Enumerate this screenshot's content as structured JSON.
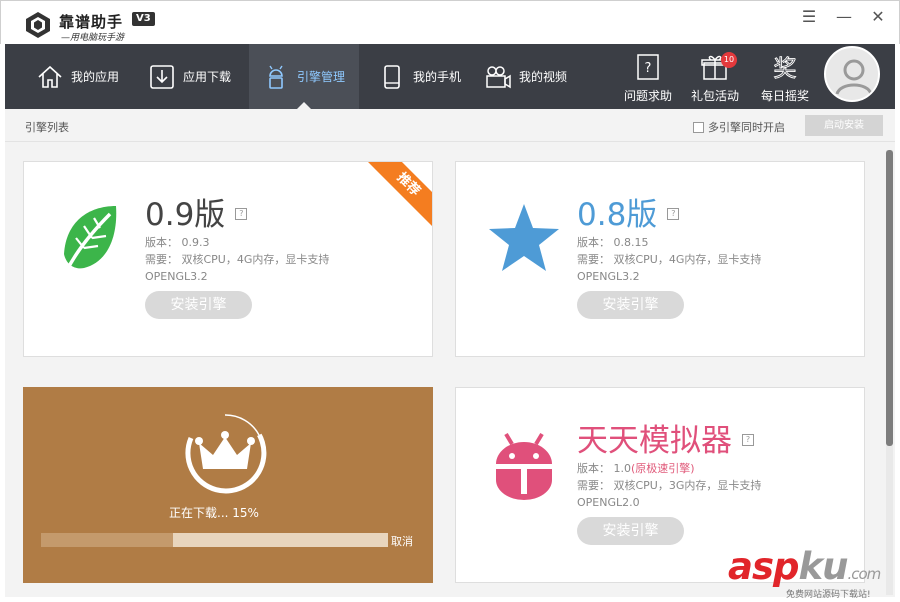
{
  "app": {
    "name": "靠谱助手",
    "slogan": "—用电脑玩手游",
    "version_badge": "V3"
  },
  "window_controls": {
    "menu": "☰",
    "minimize": "—",
    "close": "✕"
  },
  "nav": {
    "tabs": [
      {
        "label": "我的应用",
        "icon": "home-icon",
        "active": false
      },
      {
        "label": "应用下载",
        "icon": "download-icon",
        "active": false
      },
      {
        "label": "引擎管理",
        "icon": "android-icon",
        "active": true
      },
      {
        "label": "我的手机",
        "icon": "phone-icon",
        "active": false
      },
      {
        "label": "我的视频",
        "icon": "video-camera-icon",
        "active": false
      }
    ],
    "tools": [
      {
        "label": "问题求助",
        "icon": "help-book-icon"
      },
      {
        "label": "礼包活动",
        "icon": "gift-icon",
        "badge": "10"
      },
      {
        "label": "每日摇奖",
        "icon": "prize-icon",
        "glyph": "奖"
      }
    ]
  },
  "subbar": {
    "title": "引擎列表",
    "multi_engine_label": "多引擎同时开启",
    "multi_engine_checked": false,
    "auto_install_label": "启动安装"
  },
  "engines": [
    {
      "title": "0.9版",
      "help": "?",
      "version_line": "版本：  0.9.3",
      "requirement_line": "需要：  双核CPU，4G内存，显卡支持",
      "opengl_line": "OPENGL3.2",
      "install_label": "安装引擎",
      "ribbon": "推荐",
      "icon": "leaf-icon",
      "title_color": "#444444"
    },
    {
      "title": "0.8版",
      "help": "?",
      "version_line": "版本：  0.8.15",
      "requirement_line": "需要：  双核CPU，4G内存，显卡支持",
      "opengl_line": "OPENGL3.2",
      "install_label": "安装引擎",
      "icon": "star-icon",
      "title_color": "#4e9bd6"
    },
    {
      "title": "天天模拟器",
      "help": "?",
      "version_prefix": "版本：  1.0",
      "version_note": "(原极速引擎)",
      "requirement_line": "需要：  双核CPU，3G内存，显卡支持",
      "opengl_line": "OPENGL2.0",
      "install_label": "安装引擎",
      "icon": "android-bot-icon",
      "title_color": "#e0507b"
    }
  ],
  "download": {
    "status_text": "正在下载... 15%",
    "progress": 0.38,
    "cancel_label": "取消",
    "icon": "crown-icon"
  },
  "watermark": {
    "brand_a": "asp",
    "brand_b": "ku",
    "tld": ".com",
    "tagline": "免费网站源码下载站!"
  },
  "colors": {
    "nav_bg": "#3b3e45",
    "accent_blue": "#4e9bd6",
    "ribbon_orange": "#f47d20",
    "download_bg": "#b07c45",
    "brand_red": "#e1252a"
  }
}
